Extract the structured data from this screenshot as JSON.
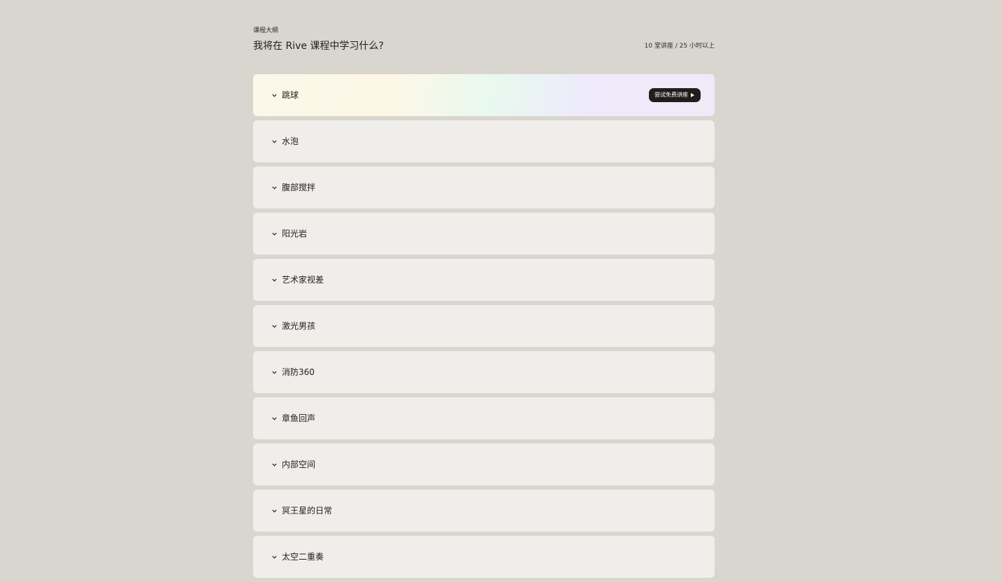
{
  "section": {
    "eyebrow": "课程大纲",
    "heading": "我将在 Rive 课程中学习什么?",
    "summary": "10 堂讲座 / 25 小时以上"
  },
  "modules": [
    {
      "title": "跳球",
      "button_label": "尝试免费讲座"
    },
    {
      "title": "水泡"
    },
    {
      "title": "腹部搅拌"
    },
    {
      "title": "阳光岩"
    },
    {
      "title": "艺术家视差"
    },
    {
      "title": "激光男孩"
    },
    {
      "title": "消防360"
    },
    {
      "title": "章鱼回声"
    },
    {
      "title": "内部空间"
    },
    {
      "title": "冥王星的日常"
    },
    {
      "title": "太空二重奏"
    }
  ],
  "icons": {
    "expand": "chevron-down-icon",
    "play": "play-icon"
  },
  "colors": {
    "page_background": "#d9d6cf",
    "card_background": "#f0eeeb",
    "button_background": "#1f1e1c",
    "text": "#1f1e1c"
  }
}
